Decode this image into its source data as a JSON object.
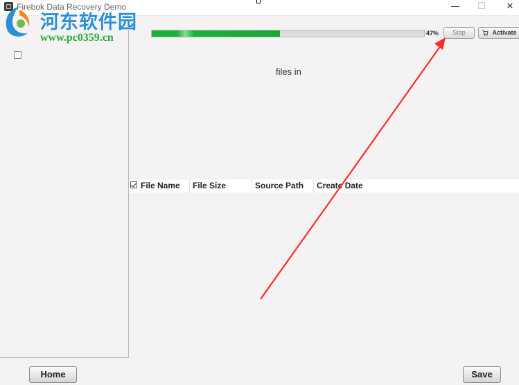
{
  "window": {
    "title": "Firebok Data Recovery Demo",
    "minimize_glyph": "—",
    "maximize_glyph": "☐",
    "close_glyph": "✕"
  },
  "watermark": {
    "name": "河东软件园",
    "url": "www.pc0359.cn"
  },
  "scan": {
    "progress_percent": 47,
    "progress_label": "47%",
    "stop_label": "Stop",
    "activate_label": "Activate",
    "status_text": "files in"
  },
  "table": {
    "columns": [
      "File Name",
      "File Size",
      "Source Path",
      "Create Date"
    ],
    "header_checked": true
  },
  "footer": {
    "home_label": "Home",
    "save_label": "Save"
  },
  "annotation": {
    "arrow_color": "#ff2a2a"
  },
  "colors": {
    "progress_green": "#19b33a",
    "watermark_blue": "#2a8fd6",
    "watermark_green": "#2cab3a"
  }
}
